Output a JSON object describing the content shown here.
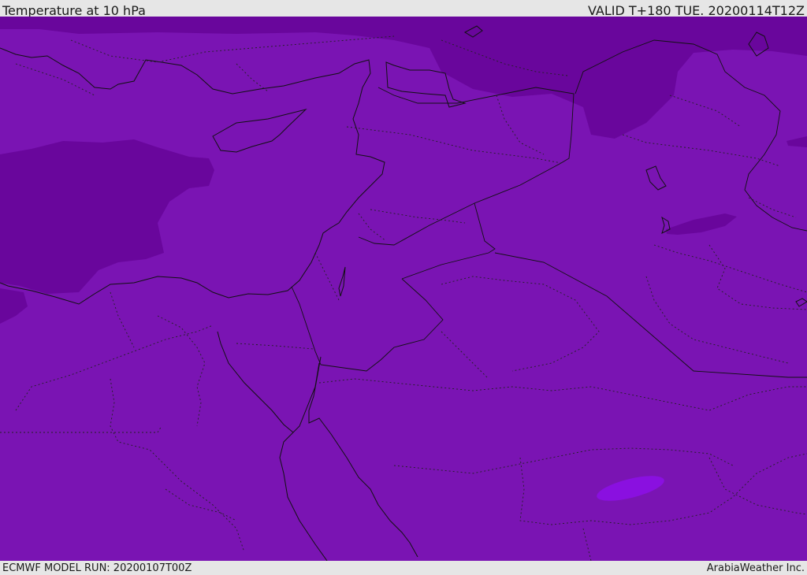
{
  "header": {
    "title": "Temperature at 10 hPa",
    "valid": "VALID T+180 TUE. 20200114T12Z"
  },
  "footer": {
    "run": "ECMWF MODEL RUN: 20200107T00Z",
    "credit": "ArabiaWeather Inc."
  },
  "map": {
    "colors": {
      "base_field": "#7a14b3",
      "cold_field": "#69069c",
      "warm_spot": "#8a10e0",
      "border": "#111111"
    }
  }
}
